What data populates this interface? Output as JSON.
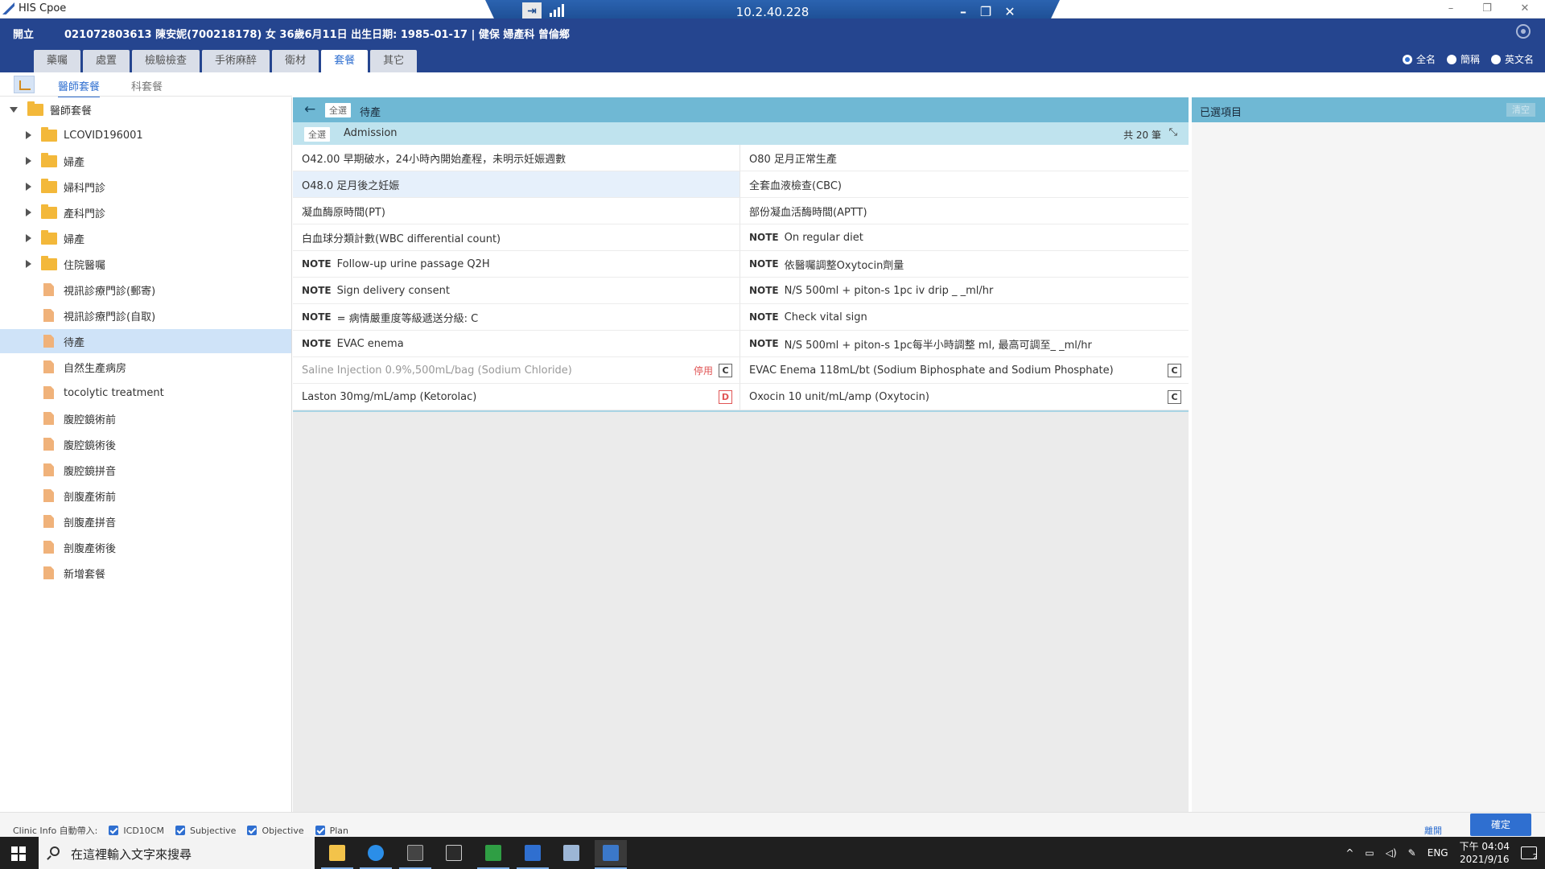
{
  "window": {
    "title": "HIS Cpoe"
  },
  "remote": {
    "address": "10.2.40.228",
    "pin_icon": "pin-icon",
    "signal_icon": "signal-icon"
  },
  "patient": {
    "open_label": "開立",
    "info": "021072803613  陳安妮(700218178)  女  36歲6月11日  出生日期: 1985-01-17  |  健保  婦產科  曾倫鄉"
  },
  "tabs": [
    {
      "label": "藥囑",
      "active": false
    },
    {
      "label": "處置",
      "active": false
    },
    {
      "label": "檢驗檢查",
      "active": false
    },
    {
      "label": "手術麻醉",
      "active": false
    },
    {
      "label": "衛材",
      "active": false
    },
    {
      "label": "套餐",
      "active": true
    },
    {
      "label": "其它",
      "active": false
    }
  ],
  "name_options": [
    {
      "label": "全名",
      "selected": true
    },
    {
      "label": "簡稱",
      "selected": false
    },
    {
      "label": "英文名",
      "selected": false
    }
  ],
  "subtabs": [
    {
      "label": "醫師套餐",
      "active": true
    },
    {
      "label": "科套餐",
      "active": false
    }
  ],
  "tree": {
    "root": "醫師套餐",
    "items": [
      {
        "label": "LCOVID196001",
        "type": "folder"
      },
      {
        "label": "婦產",
        "type": "folder"
      },
      {
        "label": "婦科門診",
        "type": "folder"
      },
      {
        "label": "產科門診",
        "type": "folder"
      },
      {
        "label": "婦產",
        "type": "folder"
      },
      {
        "label": "住院醫囑",
        "type": "folder"
      },
      {
        "label": "視訊診療門診(郵寄)",
        "type": "doc"
      },
      {
        "label": "視訊診療門診(自取)",
        "type": "doc"
      },
      {
        "label": "待產",
        "type": "doc",
        "selected": true
      },
      {
        "label": "自然生產病房",
        "type": "doc"
      },
      {
        "label": "tocolytic treatment",
        "type": "doc"
      },
      {
        "label": "腹腔鏡術前",
        "type": "doc"
      },
      {
        "label": "腹腔鏡術後",
        "type": "doc"
      },
      {
        "label": "腹腔鏡拼音",
        "type": "doc"
      },
      {
        "label": "剖腹產術前",
        "type": "doc"
      },
      {
        "label": "剖腹產拼音",
        "type": "doc"
      },
      {
        "label": "剖腹產術後",
        "type": "doc"
      },
      {
        "label": "新增套餐",
        "type": "doc"
      }
    ]
  },
  "center": {
    "select_all_chip": "全選",
    "breadcrumb_title": "待產",
    "sub_title": "Admission",
    "count": "共 20 筆"
  },
  "orders": [
    [
      {
        "note": "",
        "text": "O42.00 早期破水，24小時內開始產程，未明示妊娠週數"
      },
      {
        "note": "",
        "text": "O80 足月正常生產"
      }
    ],
    [
      {
        "note": "",
        "text": "O48.0 足月後之妊娠",
        "highlight": true
      },
      {
        "note": "",
        "text": "全套血液檢查(CBC)"
      }
    ],
    [
      {
        "note": "",
        "text": "凝血酶原時間(PT)"
      },
      {
        "note": "",
        "text": "部份凝血活酶時間(APTT)"
      }
    ],
    [
      {
        "note": "",
        "text": "白血球分類計數(WBC differential count)"
      },
      {
        "note": "NOTE",
        "text": "On regular diet"
      }
    ],
    [
      {
        "note": "NOTE",
        "text": "Follow-up urine passage Q2H"
      },
      {
        "note": "NOTE",
        "text": "依醫囑調整Oxytocin劑量"
      }
    ],
    [
      {
        "note": "NOTE",
        "text": "Sign delivery consent"
      },
      {
        "note": "NOTE",
        "text": "N/S 500ml + piton-s 1pc iv drip _ _ml/hr"
      }
    ],
    [
      {
        "note": "NOTE",
        "text": "= 病情嚴重度等級遞送分級: C"
      },
      {
        "note": "NOTE",
        "text": "Check vital sign"
      }
    ],
    [
      {
        "note": "NOTE",
        "text": "EVAC enema"
      },
      {
        "note": "NOTE",
        "text": "N/S 500ml + piton-s 1pc每半小時調整 ml, 最高可調至_ _ml/hr"
      }
    ],
    [
      {
        "note": "",
        "text": "Saline Injection 0.9%,500mL/bag (Sodium Chloride)",
        "muted": true,
        "status": "停用",
        "badge": "C"
      },
      {
        "note": "",
        "text": "EVAC Enema 118mL/bt (Sodium Biphosphate and Sodium Phosphate)",
        "badge": "C"
      }
    ],
    [
      {
        "note": "",
        "text": "Laston 30mg/mL/amp (Ketorolac)",
        "badge": "D",
        "badge_color": "#e05555"
      },
      {
        "note": "",
        "text": "Oxocin 10 unit/mL/amp (Oxytocin)",
        "badge": "C"
      }
    ]
  ],
  "selected_panel": {
    "title": "已選項目",
    "clear_label": "清空"
  },
  "bottom": {
    "clinic_label": "Clinic Info 自動帶入:",
    "checks": [
      {
        "label": "ICD10CM",
        "checked": true
      },
      {
        "label": "Subjective",
        "checked": true
      },
      {
        "label": "Objective",
        "checked": true
      },
      {
        "label": "Plan",
        "checked": true
      }
    ],
    "close_label": "離開",
    "ok_label": "確定"
  },
  "taskbar": {
    "search_placeholder": "在這裡輸入文字來搜尋",
    "lang": "ENG",
    "time": "下午 04:04",
    "date": "2021/9/16",
    "notif_count": "2"
  },
  "colors": {
    "header": "#25458f",
    "accent": "#2f6fd0",
    "crumb": "#6fb8d4",
    "subhead": "#bfe3ee"
  }
}
